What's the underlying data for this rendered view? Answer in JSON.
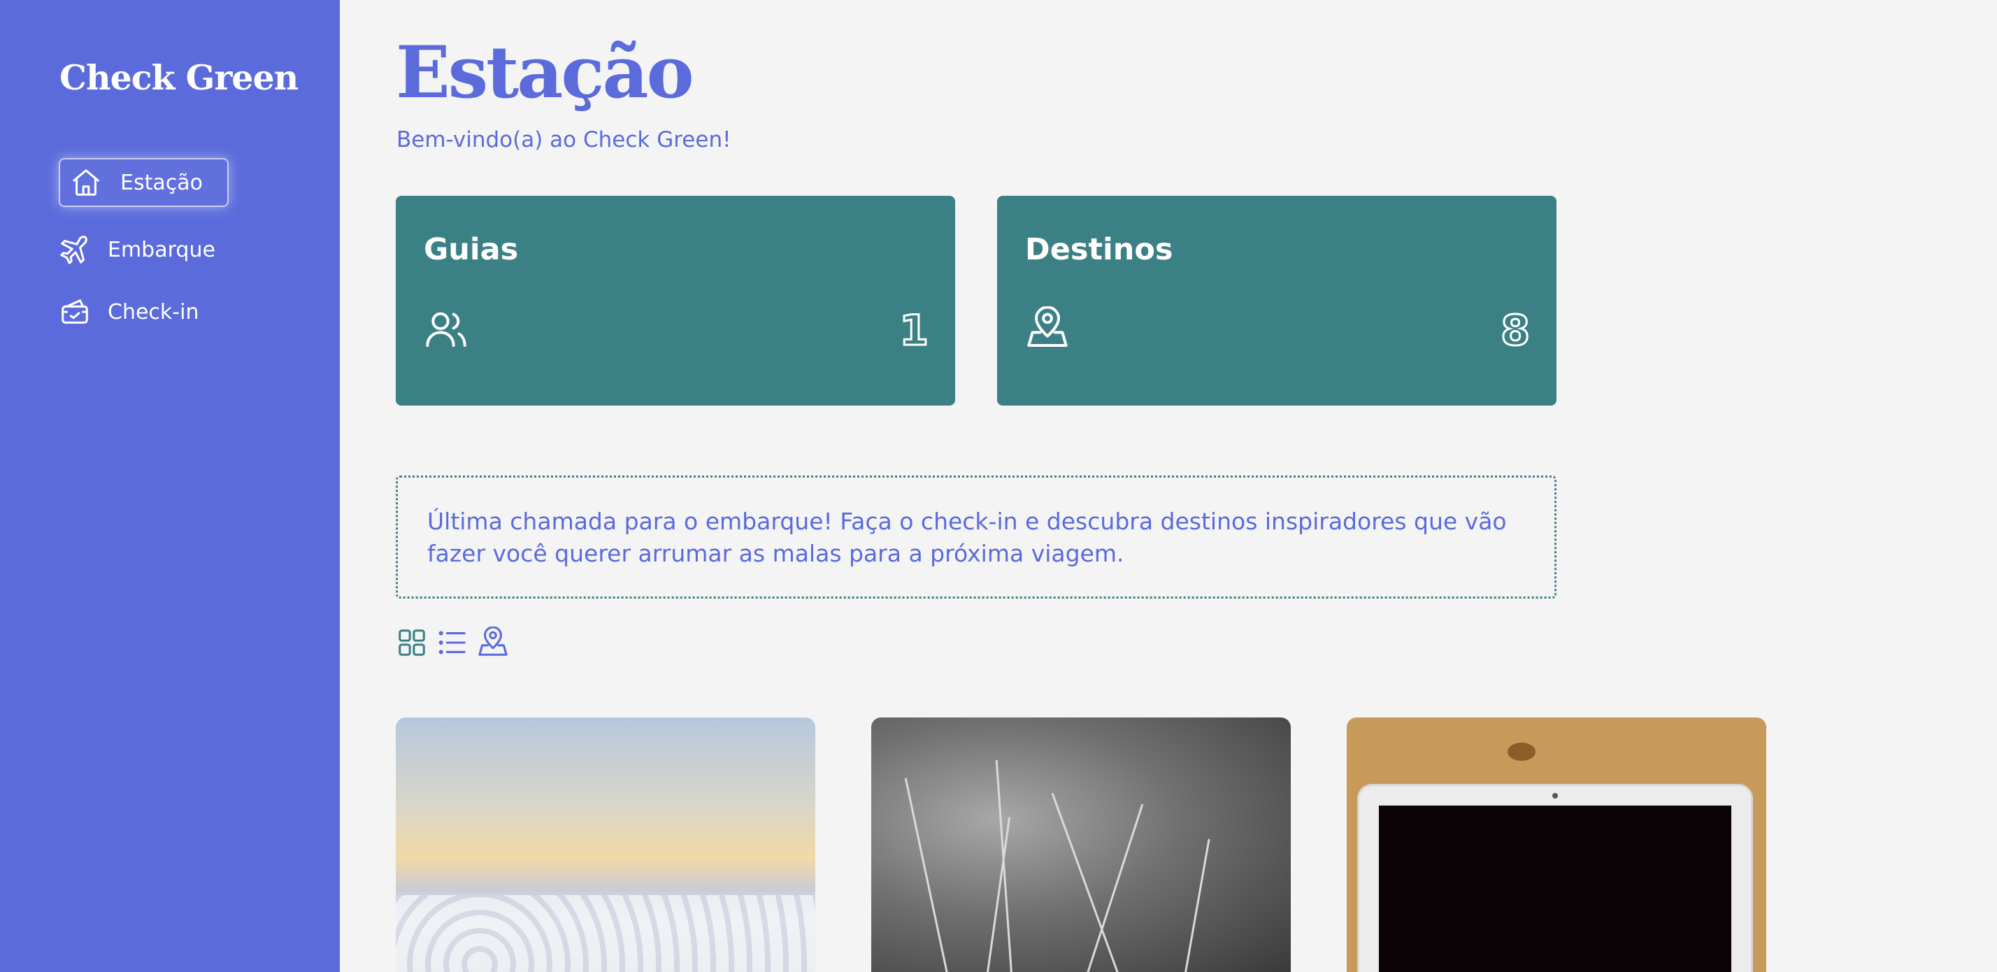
{
  "sidebar": {
    "brand": "Check Green",
    "items": [
      {
        "label": "Estação",
        "icon": "home-icon",
        "active": true
      },
      {
        "label": "Embarque",
        "icon": "airplane-icon",
        "active": false
      },
      {
        "label": "Check-in",
        "icon": "ticket-icon",
        "active": false
      }
    ]
  },
  "main": {
    "title": "Estação",
    "subtitle": "Bem-vindo(a) ao Check Green!",
    "cards": [
      {
        "title": "Guias",
        "icon": "users-icon",
        "count": "1"
      },
      {
        "title": "Destinos",
        "icon": "map-pin-icon",
        "count": "8"
      }
    ],
    "notice": "Última chamada para o embarque! Faça o check-in e descubra destinos inspiradores que vão fazer você querer arrumar as malas para a próxima viagem.",
    "view_toggles": [
      "grid-icon",
      "list-icon",
      "map-pin-icon"
    ],
    "photos": [
      "sunrise-clouds-photo",
      "grass-photo",
      "laptop-photo"
    ]
  },
  "colors": {
    "primary": "#5b6bdb",
    "card": "#3b8084",
    "background": "#f4f4f4"
  }
}
